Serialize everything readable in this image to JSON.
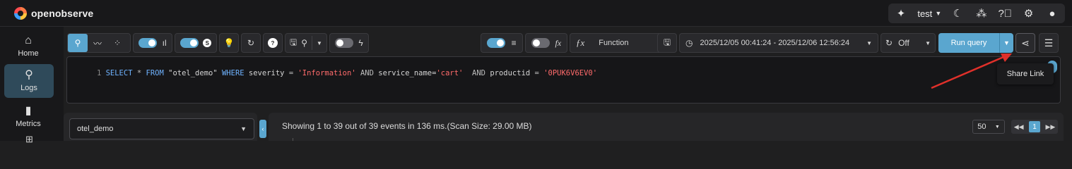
{
  "app": {
    "name": "openobserve"
  },
  "header": {
    "org": "test"
  },
  "nav": [
    {
      "label": "Home",
      "icon": "home-icon"
    },
    {
      "label": "Logs",
      "icon": "search-icon"
    },
    {
      "label": "Metrics",
      "icon": "bar-chart-icon"
    }
  ],
  "toolbar": {
    "fx_label": "fx",
    "function_label": "Function",
    "date_range": "2025/12/05 00:41:24 - 2025/12/06 12:56:24",
    "refresh_label": "Off",
    "run_query": "Run query"
  },
  "query": {
    "line_number": "1",
    "tokens": [
      {
        "t": "SELECT",
        "c": "kw"
      },
      {
        "t": " * ",
        "c": "op"
      },
      {
        "t": "FROM",
        "c": "kw"
      },
      {
        "t": " \"otel_demo\" ",
        "c": "id"
      },
      {
        "t": "WHERE",
        "c": "kw"
      },
      {
        "t": " severity ",
        "c": "id"
      },
      {
        "t": "= ",
        "c": "op"
      },
      {
        "t": "'Information'",
        "c": "str"
      },
      {
        "t": " AND ",
        "c": "op"
      },
      {
        "t": "service_name=",
        "c": "id"
      },
      {
        "t": "'cart'",
        "c": "str"
      },
      {
        "t": "  AND ",
        "c": "op"
      },
      {
        "t": "productid ",
        "c": "id"
      },
      {
        "t": "= ",
        "c": "op"
      },
      {
        "t": "'0PUK6V6EV0'",
        "c": "str"
      }
    ]
  },
  "tooltip": {
    "share_link": "Share Link"
  },
  "stream": {
    "selected": "otel_demo"
  },
  "results": {
    "status": "Showing 1 to 39 out of 39 events in 136 ms.(Scan Size: 29.00 MB)",
    "page_size": "50",
    "current_page": "1"
  },
  "colors": {
    "accent": "#5aa6cf",
    "annotation_arrow": "#e0302a"
  }
}
